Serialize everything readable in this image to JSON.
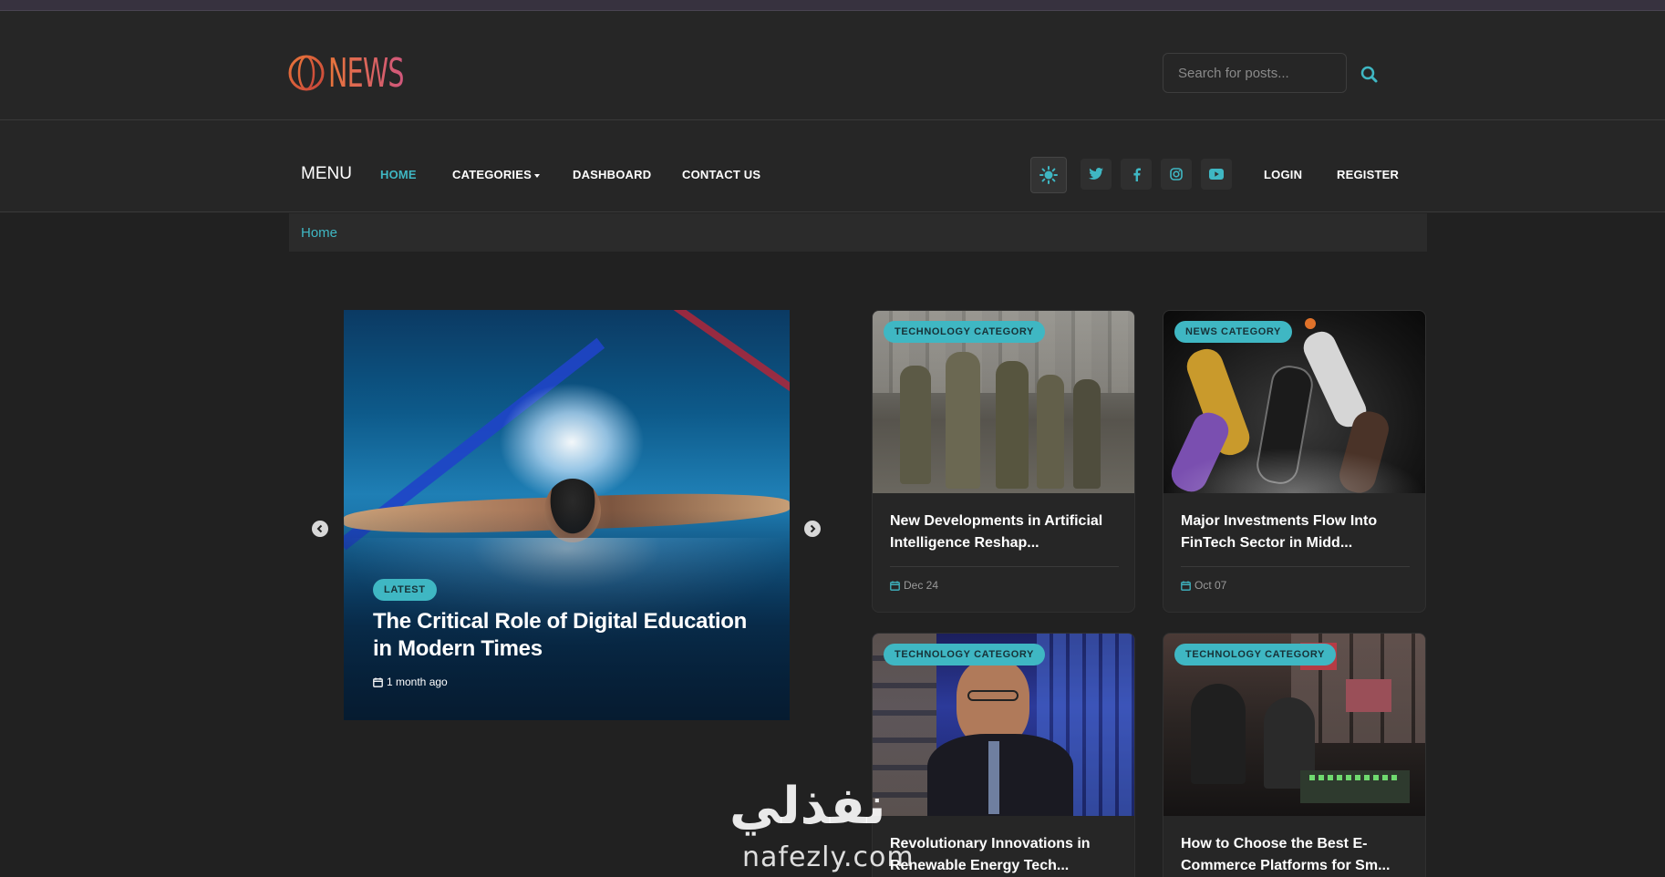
{
  "header": {
    "logo_text": "NEWS",
    "search": {
      "placeholder": "Search for posts..."
    }
  },
  "nav": {
    "menu_label": "MENU",
    "links": [
      {
        "label": "HOME",
        "active": true
      },
      {
        "label": "CATEGORIES",
        "dropdown": true
      },
      {
        "label": "DASHBOARD"
      },
      {
        "label": "CONTACT US"
      }
    ],
    "social_icons": [
      "twitter-icon",
      "facebook-icon",
      "instagram-icon",
      "youtube-icon"
    ],
    "theme_icon": "sun-icon",
    "login_label": "LOGIN",
    "register_label": "REGISTER"
  },
  "breadcrumb": {
    "home": "Home"
  },
  "slider": {
    "badge": "LATEST",
    "title": "The Critical Role of Digital Education in Modern Times",
    "date": "1 month ago"
  },
  "cards": [
    {
      "category": "TECHNOLOGY CATEGORY",
      "title": "New Developments in Artificial Intelligence Reshap...",
      "date": "Dec 24"
    },
    {
      "category": "NEWS CATEGORY",
      "title": "Major Investments Flow Into FinTech Sector in Midd...",
      "date": "Oct 07"
    },
    {
      "category": "TECHNOLOGY CATEGORY",
      "title": "Revolutionary Innovations in Renewable Energy Tech..."
    },
    {
      "category": "TECHNOLOGY CATEGORY",
      "title": "How to Choose the Best E-Commerce Platforms for Sm..."
    }
  ],
  "watermark": {
    "arabic": "نفذلي",
    "latin": "nafezly.com"
  },
  "colors": {
    "accent": "#3fb7c3",
    "background": "#212121",
    "panel": "#262626"
  }
}
